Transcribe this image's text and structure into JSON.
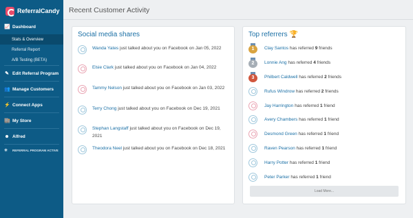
{
  "brand": {
    "name": "ReferralCandy"
  },
  "sidebar": {
    "dashboard": "Dashboard",
    "subitems": [
      "Stats & Overview",
      "Referral Report",
      "A/B Testing (BETA)"
    ],
    "items": [
      "Edit Referral Program",
      "Manage Customers",
      "Connect Apps",
      "My Store",
      "Alfred"
    ],
    "status": "REFERRAL PROGRAM ACTIVE"
  },
  "page": {
    "title": "Recent Customer Activity"
  },
  "social": {
    "title": "Social media shares",
    "shares": [
      {
        "name": "Wanda Yates",
        "text": "just talked about you on Facebook on Jan 05, 2022"
      },
      {
        "name": "Elsie Clark",
        "text": "just talked about you on Facebook on Jan 04, 2022"
      },
      {
        "name": "Tammy Nelson",
        "text": "just talked about you on Facebook on Jan 03, 2022"
      },
      {
        "name": "Terry Chong",
        "text": "just talked about you on Facebook on Dec 19, 2021"
      },
      {
        "name": "Stephan Langstaff",
        "text": "just talked about you on Facebook on Dec 19, 2021"
      },
      {
        "name": "Theodora Neel",
        "text": "just talked about you on Facebook on Dec 18, 2021"
      }
    ]
  },
  "referrers": {
    "title": "Top referrers 🏆",
    "rows": [
      {
        "name": "Clay Santos",
        "prefix": "has referred",
        "count": "9",
        "suffix": "friends"
      },
      {
        "name": "Lonnie Ang",
        "prefix": "has referred",
        "count": "4",
        "suffix": "friends"
      },
      {
        "name": "Philbert Caldwell",
        "prefix": "has referred",
        "count": "2",
        "suffix": "friends"
      },
      {
        "name": "Rufus Windrow",
        "prefix": "has referred",
        "count": "2",
        "suffix": "friends"
      },
      {
        "name": "Jay Harrington",
        "prefix": "has referred",
        "count": "1",
        "suffix": "friend"
      },
      {
        "name": "Avery Chambers",
        "prefix": "has referred",
        "count": "1",
        "suffix": "friend"
      },
      {
        "name": "Desmond Green",
        "prefix": "has referred",
        "count": "1",
        "suffix": "friend"
      },
      {
        "name": "Raven Pearson",
        "prefix": "has referred",
        "count": "1",
        "suffix": "friend"
      },
      {
        "name": "Harry Potter",
        "prefix": "has referred",
        "count": "1",
        "suffix": "friend"
      },
      {
        "name": "Peter Parker",
        "prefix": "has referred",
        "count": "1",
        "suffix": "friend"
      }
    ],
    "medals": [
      "1",
      "2",
      "3"
    ],
    "load_more": "Load More..."
  },
  "colors": {
    "sidebar": "#0d5b86",
    "link": "#1a6fa5",
    "brand": "#e94b6a"
  }
}
